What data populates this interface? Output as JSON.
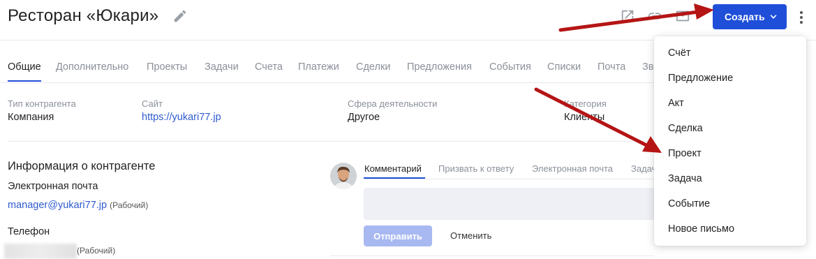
{
  "header": {
    "title": "Ресторан «Юкари»",
    "create_label": "Создать",
    "accent_color": "#1f4fd9"
  },
  "tabs": [
    "Общие",
    "Дополнительно",
    "Проекты",
    "Задачи",
    "Счета",
    "Платежи",
    "Сделки",
    "Предложения",
    "События",
    "Списки",
    "Почта",
    "Зв"
  ],
  "info": {
    "type_label": "Тип контрагента",
    "type_value": "Компания",
    "site_label": "Сайт",
    "site_value": "https://yukari77.jp",
    "sphere_label": "Сфера деятельности",
    "sphere_value": "Другое",
    "category_label": "Категория",
    "category_value": "Клиенты"
  },
  "contact": {
    "section_title": "Информация о контрагенте",
    "email_label": "Электронная почта",
    "email_value": "manager@yukari77.jp",
    "email_type": "(Рабочий)",
    "phone_label": "Телефон",
    "phone_type": "(Рабочий)"
  },
  "comment": {
    "tabs": [
      "Комментарий",
      "Призвать к ответу",
      "Электронная почта",
      "Задач"
    ],
    "send_label": "Отправить",
    "cancel_label": "Отменить",
    "at": "@",
    "more": "..."
  },
  "menu": {
    "items": [
      "Счёт",
      "Предложение",
      "Акт",
      "Сделка",
      "Проект",
      "Задача",
      "Событие",
      "Новое письмо"
    ]
  },
  "icons": [
    "edit-icon",
    "external-link-icon",
    "link-icon",
    "email-icon",
    "chevron-down-icon",
    "more-vertical-icon",
    "avatar-photo"
  ]
}
